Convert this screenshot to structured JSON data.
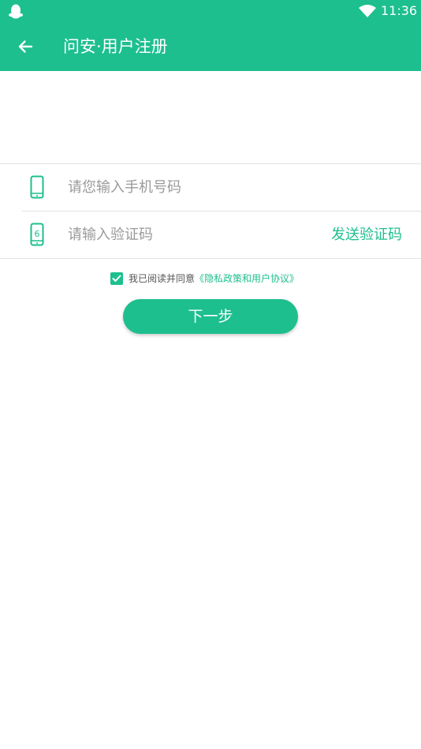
{
  "status_bar": {
    "time": "11:36",
    "left_icon": "qq-penguin-icon",
    "wifi_icon": "wifi-icon"
  },
  "header": {
    "back_icon": "arrow-left-icon",
    "title": "问安·用户注册"
  },
  "form": {
    "phone": {
      "icon": "phone-icon",
      "value": "",
      "placeholder": "请您输入手机号码"
    },
    "code": {
      "icon": "phone-code-icon",
      "icon_digit": "6",
      "value": "",
      "placeholder": "请输入验证码",
      "send_label": "发送验证码"
    }
  },
  "agreement": {
    "checked": true,
    "text": "我已阅读并同意",
    "link": "《隐私政策和用户协议》"
  },
  "next_button": {
    "label": "下一步"
  },
  "colors": {
    "primary": "#1dbf8e",
    "divider": "#e2e2e2",
    "placeholder": "#9a9a9a",
    "text": "#555555"
  }
}
